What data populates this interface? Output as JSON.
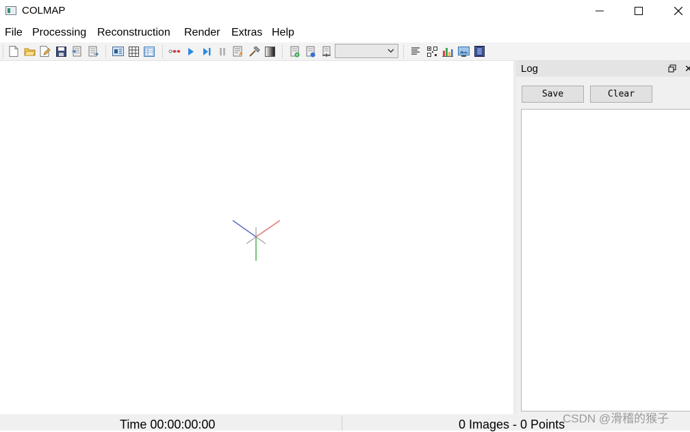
{
  "window": {
    "title": "COLMAP"
  },
  "menu": {
    "items": [
      "File",
      "Processing",
      "Reconstruction",
      "Render",
      "Extras",
      "Help"
    ]
  },
  "toolbar": {
    "icons": [
      "new-project-icon",
      "open-project-icon",
      "edit-project-icon",
      "save-project-icon",
      "import-icon",
      "export-icon",
      "feature-extraction-icon",
      "feature-matching-icon",
      "database-management-icon",
      "automatic-reconstruction-icon",
      "start-reconstruction-icon",
      "step-reconstruction-icon",
      "pause-reconstruction-icon",
      "reconstruction-options-icon",
      "bundle-adjustment-icon",
      "dense-reconstruction-icon",
      "render-options-icon",
      "grab-image-icon",
      "grab-movie-icon",
      "show-log-icon",
      "match-matrix-icon",
      "reconstruction-stats-icon",
      "undistort-icon",
      "movie-icon"
    ],
    "reconstruction_select": ""
  },
  "colors": {
    "axis_x": "#e57373",
    "axis_y": "#4caf50",
    "axis_z": "#5c6bc0"
  },
  "log_panel": {
    "title": "Log",
    "save_label": "Save",
    "clear_label": "Clear",
    "content": ""
  },
  "status": {
    "time": "Time 00:00:00:00",
    "counts": "0 Images - 0 Points"
  },
  "watermark": "CSDN @滑稽的猴子"
}
